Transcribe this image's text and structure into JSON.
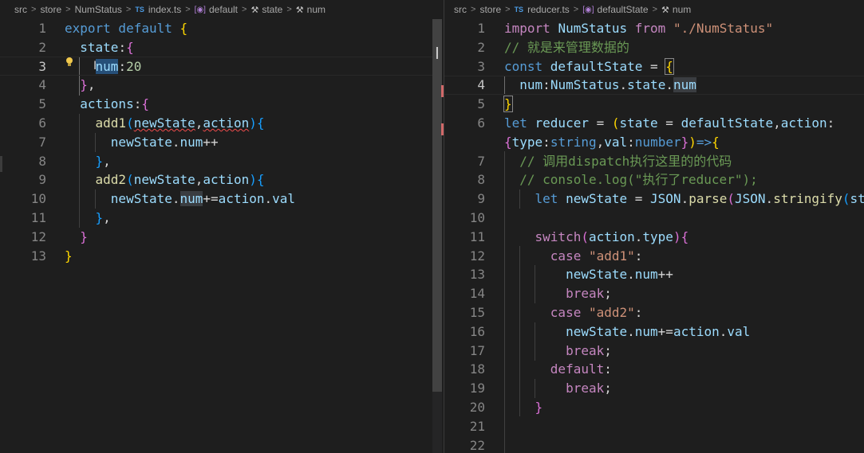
{
  "left": {
    "breadcrumb": [
      "src",
      "store",
      "NumStatus",
      "index.ts",
      "default",
      "state",
      "num"
    ],
    "file_badge": "TS",
    "lines": [
      {
        "n": "1",
        "html": "<span class='kw'>export default </span><span class='b1'>{</span>"
      },
      {
        "n": "2",
        "html": "  <span class='prop'>state</span><span class='p'>:</span><span class='b2'>{</span>"
      },
      {
        "n": "3",
        "html": "    <span class='prop hl'>num</span><span class='p'>:</span><span class='num'>20</span>"
      },
      {
        "n": "4",
        "html": "  <span class='b2'>}</span><span class='p'>,</span>"
      },
      {
        "n": "5",
        "html": "  <span class='prop'>actions</span><span class='p'>:</span><span class='b2'>{</span>"
      },
      {
        "n": "6",
        "html": "    <span class='fn'>add1</span><span class='b3'>(</span><span class='prop squig'>newState</span><span class='p'>,</span><span class='prop squig'>action</span><span class='b3'>)</span><span class='b3'>{</span>"
      },
      {
        "n": "7",
        "html": "      <span class='prop'>newState</span><span class='p'>.</span><span class='prop'>num</span><span class='p'>++</span>"
      },
      {
        "n": "8",
        "html": "    <span class='b3'>}</span><span class='p'>,</span>"
      },
      {
        "n": "9",
        "html": "    <span class='fn'>add2</span><span class='b3'>(</span><span class='prop'>newState</span><span class='p'>,</span><span class='prop'>action</span><span class='b3'>)</span><span class='b3'>{</span>"
      },
      {
        "n": "10",
        "html": "      <span class='prop'>newState</span><span class='p'>.</span><span class='prop hl2'>num</span><span class='p'>+=</span><span class='prop'>action</span><span class='p'>.</span><span class='prop'>val</span>"
      },
      {
        "n": "11",
        "html": "    <span class='b3'>}</span><span class='p'>,</span>"
      },
      {
        "n": "12",
        "html": "  <span class='b2'>}</span>"
      },
      {
        "n": "13",
        "html": "<span class='b1'>}</span>"
      }
    ]
  },
  "right": {
    "breadcrumb": [
      "src",
      "store",
      "reducer.ts",
      "defaultState",
      "num"
    ],
    "file_badge": "TS",
    "lines": [
      {
        "n": "1",
        "html": "<span class='ctl'>import </span><span class='prop'>NumStatus </span><span class='ctl'>from </span><span class='str'>\"./NumStatus\"</span>"
      },
      {
        "n": "2",
        "html": "<span class='cm'>// 就是来管理数据的</span>"
      },
      {
        "n": "3",
        "html": "<span class='kw'>const </span><span class='prop'>defaultState </span><span class='p'>= </span><span class='b1 bmatch'>{</span>"
      },
      {
        "n": "4",
        "html": "  <span class='prop'>num</span><span class='p'>:</span><span class='prop'>NumStatus</span><span class='p'>.</span><span class='prop'>state</span><span class='p'>.</span><span class='prop hl2'>num</span>"
      },
      {
        "n": "5",
        "html": "<span class='b1 bmatch'>}</span>"
      },
      {
        "n": "6",
        "html": "<span class='kw'>let </span><span class='prop'>reducer </span><span class='p'>= </span><span class='b1'>(</span><span class='prop'>state </span><span class='p'>= </span><span class='prop'>defaultState</span><span class='p'>,</span><span class='prop'>action</span><span class='p'>:</span>"
      },
      {
        "n": "",
        "html": "<span class='b2'>{</span><span class='prop'>type</span><span class='p'>:</span><span class='kw'>string</span><span class='p'>,</span><span class='prop'>val</span><span class='p'>:</span><span class='kw'>number</span><span class='b2'>}</span><span class='b1'>)</span><span class='kw'>=></span><span class='b1'>{</span>"
      },
      {
        "n": "7",
        "html": "  <span class='cm'>// 调用dispatch执行这里的的代码</span>"
      },
      {
        "n": "8",
        "html": "  <span class='cm'>// console.log(\"执行了reducer\");</span>"
      },
      {
        "n": "9",
        "html": "    <span class='kw'>let </span><span class='prop'>newState </span><span class='p'>= </span><span class='prop'>JSON</span><span class='p'>.</span><span class='fn'>parse</span><span class='b2'>(</span><span class='prop'>JSON</span><span class='p'>.</span><span class='fn'>stringify</span><span class='b3'>(</span><span class='prop'>st</span>"
      },
      {
        "n": "10",
        "html": ""
      },
      {
        "n": "11",
        "html": "    <span class='ctl'>switch</span><span class='b2'>(</span><span class='prop'>action</span><span class='p'>.</span><span class='prop'>type</span><span class='b2'>)</span><span class='b2'>{</span>"
      },
      {
        "n": "12",
        "html": "      <span class='ctl'>case </span><span class='str'>\"add1\"</span><span class='p'>:</span>"
      },
      {
        "n": "13",
        "html": "        <span class='prop'>newState</span><span class='p'>.</span><span class='prop'>num</span><span class='p'>++</span>"
      },
      {
        "n": "14",
        "html": "        <span class='ctl'>break</span><span class='p'>;</span>"
      },
      {
        "n": "15",
        "html": "      <span class='ctl'>case </span><span class='str'>\"add2\"</span><span class='p'>:</span>"
      },
      {
        "n": "16",
        "html": "        <span class='prop'>newState</span><span class='p'>.</span><span class='prop'>num</span><span class='p'>+=</span><span class='prop'>action</span><span class='p'>.</span><span class='prop'>val</span>"
      },
      {
        "n": "17",
        "html": "        <span class='ctl'>break</span><span class='p'>;</span>"
      },
      {
        "n": "18",
        "html": "      <span class='ctl'>default</span><span class='p'>:</span>"
      },
      {
        "n": "19",
        "html": "        <span class='ctl'>break</span><span class='p'>;</span>"
      },
      {
        "n": "20",
        "html": "    <span class='b2'>}</span>"
      },
      {
        "n": "21",
        "html": ""
      },
      {
        "n": "22",
        "html": ""
      }
    ]
  },
  "colors": {
    "keyword": "#569cd6",
    "control": "#c586c0",
    "function": "#dcdcaa",
    "variable": "#9cdcfe",
    "number": "#b5cea8",
    "string": "#ce9178",
    "comment": "#6a9955",
    "bracket_1": "#ffd700",
    "bracket_2": "#da70d6",
    "bracket_3": "#179fff",
    "editor_bg": "#1e1e1e"
  },
  "icons": {
    "lightbulb": "lightbulb-icon",
    "symbol": "symbol-namespace-icon",
    "property": "wrench-icon",
    "chevron": "chevron-right-icon"
  }
}
